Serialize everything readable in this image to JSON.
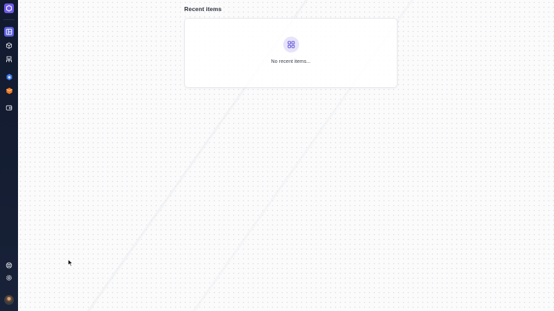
{
  "sidebar": {
    "logo_icon": "hexagon-logo-icon",
    "brand_color": "#6d5ae8",
    "items": [
      {
        "icon": "dashboard-icon",
        "active": true
      },
      {
        "icon": "cube-icon",
        "active": false
      },
      {
        "icon": "people-hierarchy-icon",
        "active": false
      },
      {
        "icon": "blue-app-icon",
        "active": false
      },
      {
        "icon": "orange-app-icon",
        "active": false
      },
      {
        "icon": "wallet-icon",
        "active": false
      }
    ],
    "bottom_items": [
      {
        "icon": "help-icon"
      },
      {
        "icon": "gear-icon"
      }
    ],
    "avatar": "user-avatar"
  },
  "main": {
    "recent": {
      "title": "Recent items",
      "empty_text": "No recent items...",
      "empty_icon": "grid-icon"
    }
  },
  "colors": {
    "sidebar_bg": "#151e33",
    "accent": "#5b5fe0",
    "empty_icon_bg": "#e6e3fb"
  }
}
